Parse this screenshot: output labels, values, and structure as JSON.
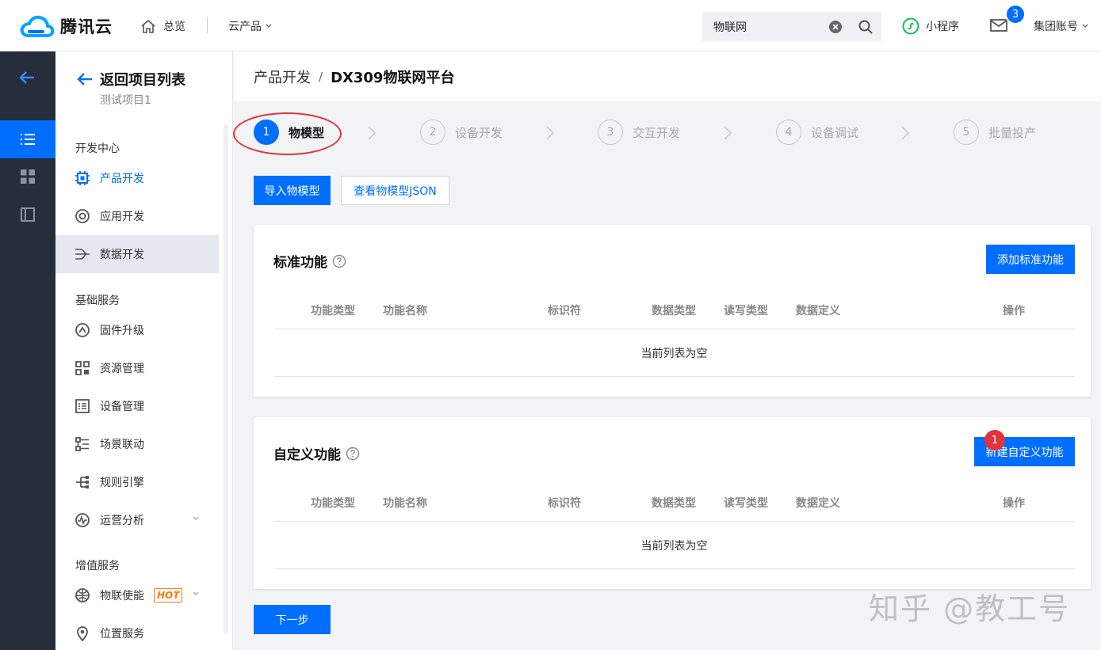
{
  "topbar": {
    "logo_text": "腾讯云",
    "home_label": "总览",
    "products_label": "云产品",
    "search_value": "物联网",
    "miniprogram_label": "小程序",
    "mail_badge": "3",
    "account_label": "集团账号"
  },
  "sidebar": {
    "back_title": "返回项目列表",
    "project_name": "测试项目1",
    "groups": [
      {
        "title": "开发中心",
        "items": [
          {
            "label": "产品开发",
            "icon": "chip-icon"
          },
          {
            "label": "应用开发",
            "icon": "target-icon"
          },
          {
            "label": "数据开发",
            "icon": "flow-icon"
          }
        ]
      },
      {
        "title": "基础服务",
        "items": [
          {
            "label": "固件升级",
            "icon": "upgrade-icon"
          },
          {
            "label": "资源管理",
            "icon": "resource-icon"
          },
          {
            "label": "设备管理",
            "icon": "device-list-icon"
          },
          {
            "label": "场景联动",
            "icon": "scene-icon"
          },
          {
            "label": "规则引擎",
            "icon": "rule-icon"
          },
          {
            "label": "运营分析",
            "icon": "analysis-icon"
          }
        ]
      },
      {
        "title": "增值服务",
        "items": [
          {
            "label": "物联使能",
            "icon": "globe-icon",
            "badge": "HOT"
          },
          {
            "label": "位置服务",
            "icon": "location-icon"
          }
        ]
      }
    ]
  },
  "breadcrumb": {
    "parent": "产品开发",
    "separator": "/",
    "current": "DX309物联网平台"
  },
  "steps": [
    {
      "num": "1",
      "label": "物模型"
    },
    {
      "num": "2",
      "label": "设备开发"
    },
    {
      "num": "3",
      "label": "交互开发"
    },
    {
      "num": "4",
      "label": "设备调试"
    },
    {
      "num": "5",
      "label": "批量投产"
    }
  ],
  "actions": {
    "import_label": "导入物模型",
    "view_json_label": "查看物模型JSON",
    "next_label": "下一步"
  },
  "standard": {
    "title": "标准功能",
    "add_label": "添加标准功能",
    "empty_text": "当前列表为空"
  },
  "custom": {
    "title": "自定义功能",
    "add_label": "新建自定义功能",
    "badge": "1",
    "empty_text": "当前列表为空"
  },
  "columns": [
    "功能类型",
    "功能名称",
    "标识符",
    "数据类型",
    "读写类型",
    "数据定义",
    "操作"
  ],
  "watermark": "知乎 @教工号",
  "colors": {
    "primary": "#006eff",
    "rail": "#262d3b",
    "highlight": "#e0343a",
    "hot": "#ff7800"
  }
}
